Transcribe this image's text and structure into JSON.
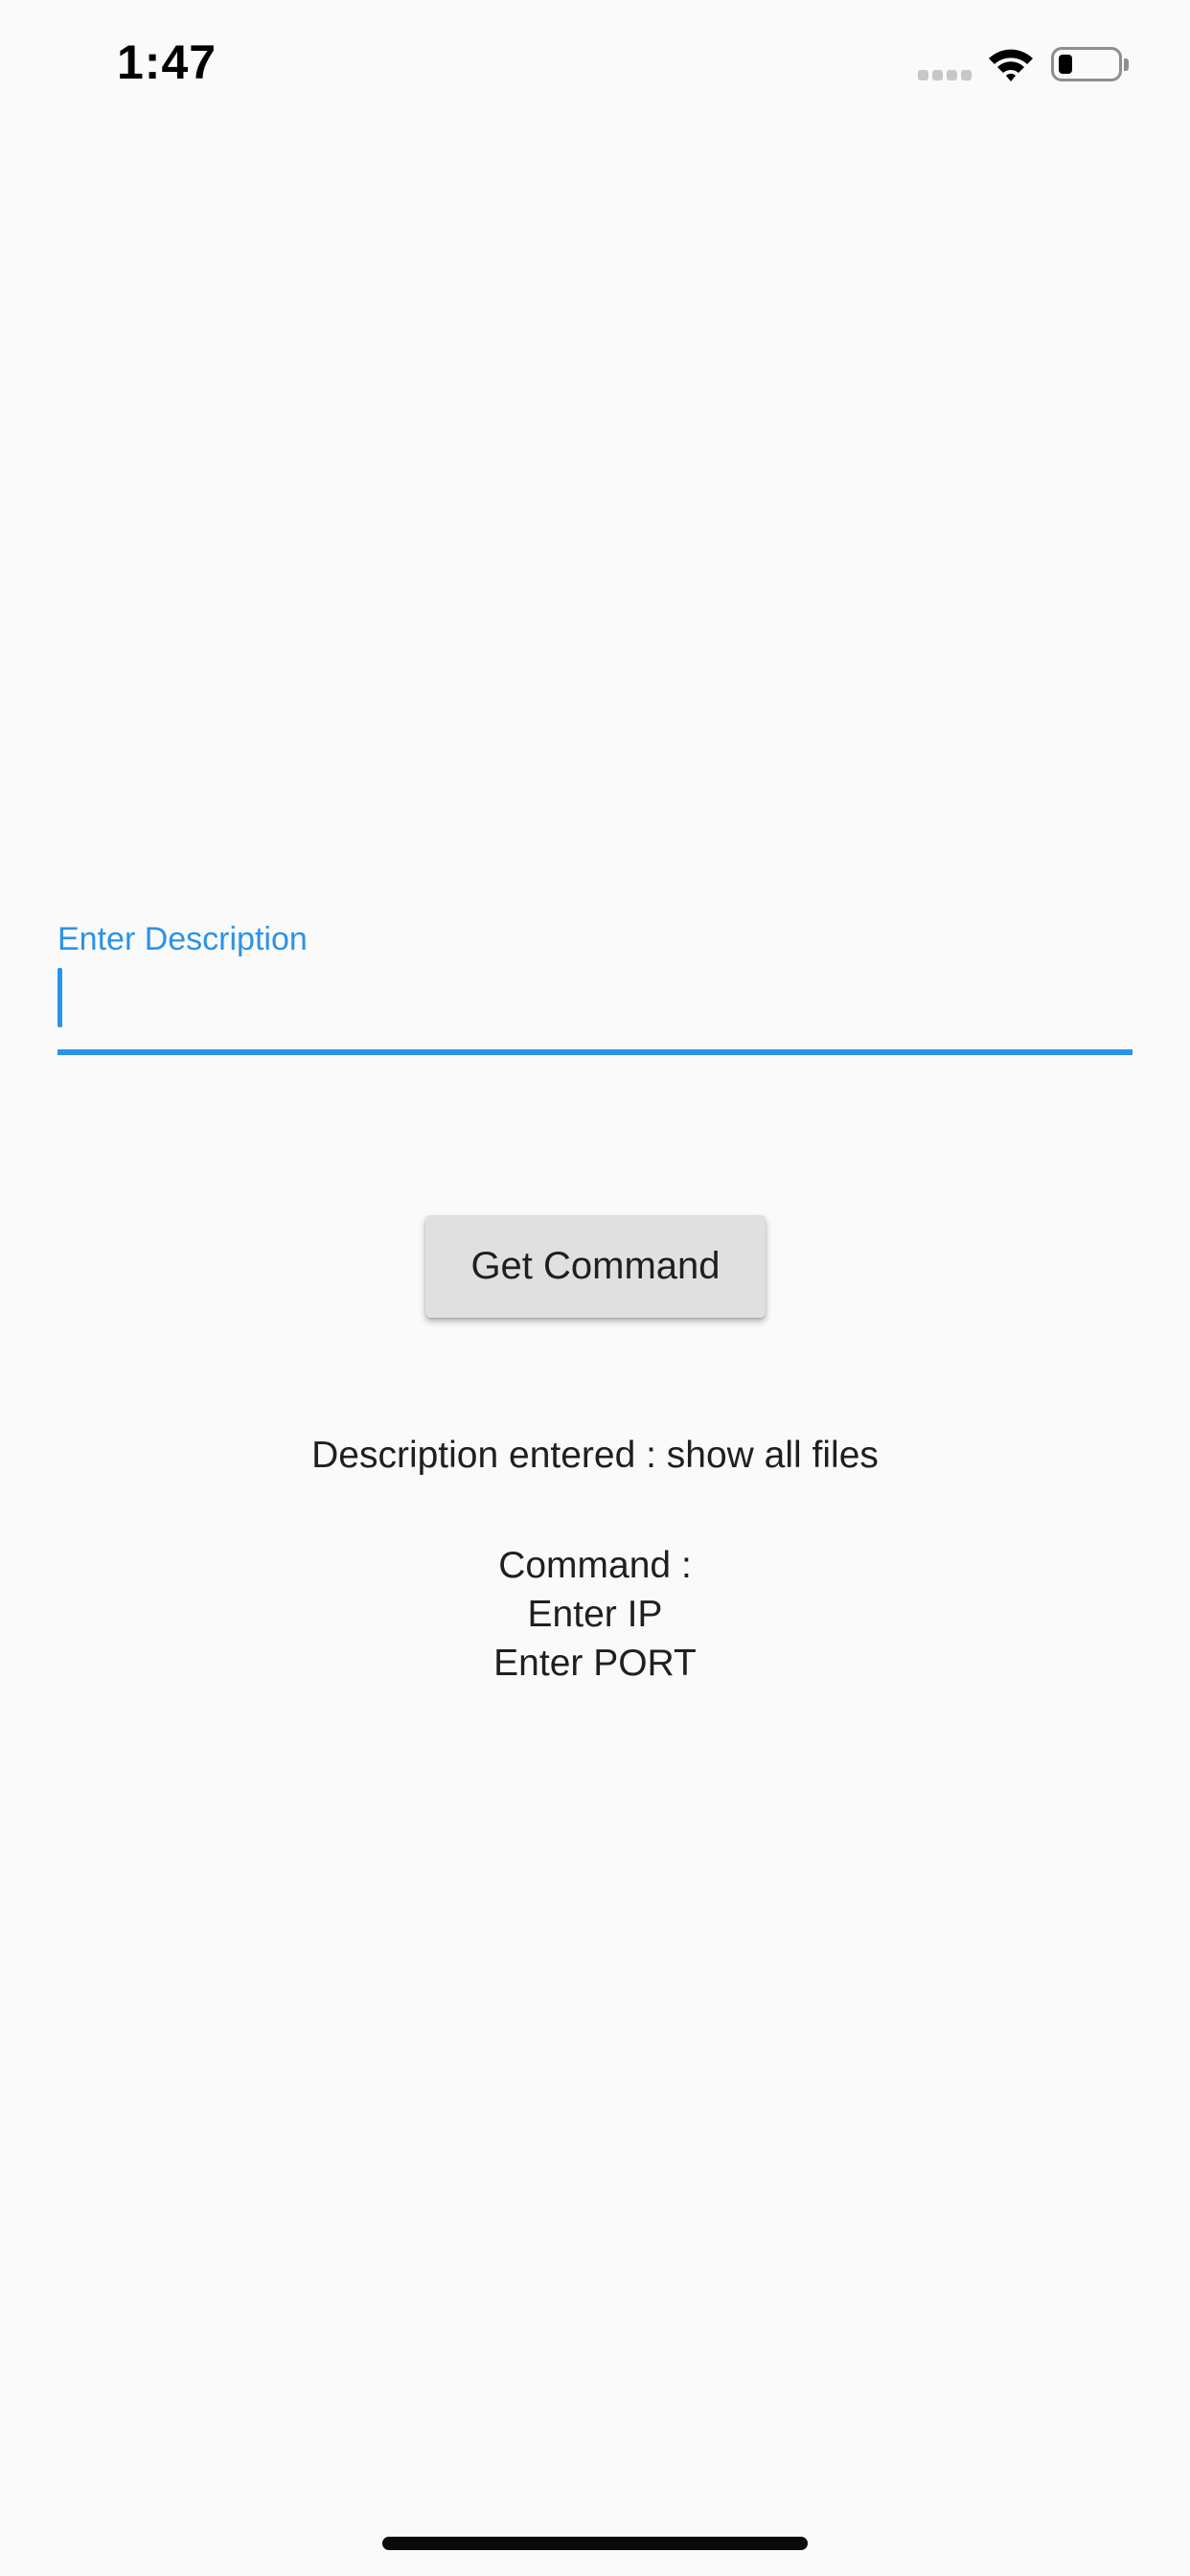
{
  "status_bar": {
    "time": "1:47",
    "icons": [
      "cellular-signal-icon",
      "wifi-icon",
      "battery-icon"
    ],
    "battery_level": 0.2
  },
  "form": {
    "label": "Enter Description",
    "value": "",
    "accent_color": "#2b93e8"
  },
  "button": {
    "label": "Get Command"
  },
  "result": {
    "description_line": "Description entered : show all files",
    "command_label": "Command :",
    "ip_line": "Enter IP",
    "port_line": "Enter PORT"
  }
}
